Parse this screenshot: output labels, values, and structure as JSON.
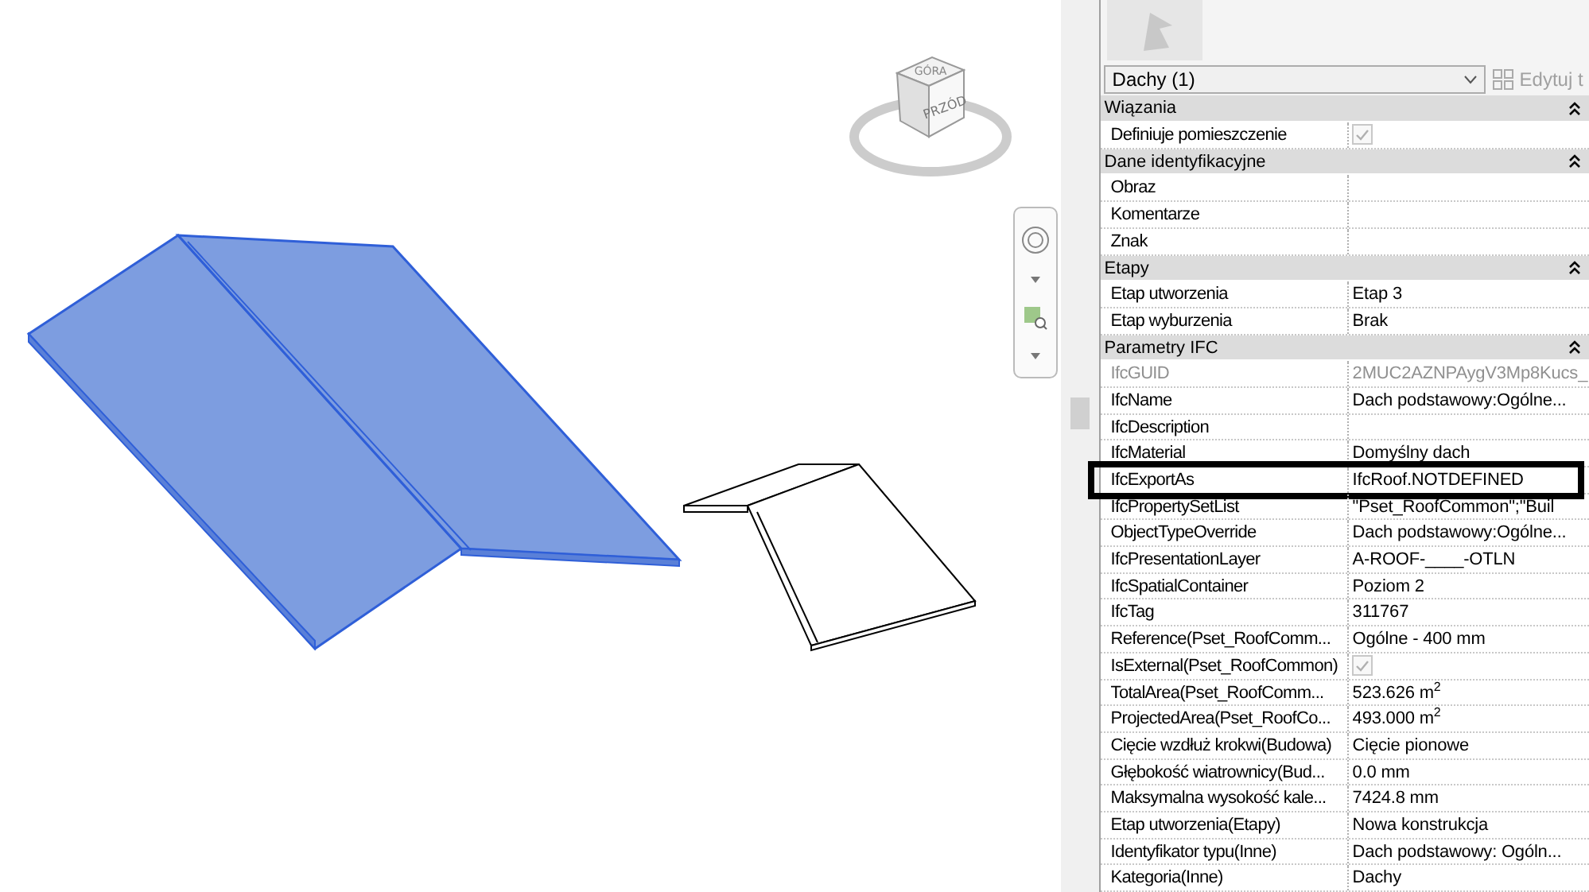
{
  "viewcube": {
    "top": "GÓRA",
    "front": "PRZÓD"
  },
  "properties": {
    "type_selector": "Dachy (1)",
    "edit_type_button": "Edytuj t",
    "rows": [
      {
        "kind": "group",
        "label": "Wiązania",
        "expanded": true
      },
      {
        "kind": "checkbox",
        "label": "Definiuje pomieszczenie",
        "checked": true
      },
      {
        "kind": "group",
        "label": "Dane identyfikacyjne",
        "expanded": true
      },
      {
        "kind": "text",
        "label": "Obraz"
      },
      {
        "kind": "text",
        "label": "Komentarze"
      },
      {
        "kind": "text",
        "label": "Znak"
      },
      {
        "kind": "group",
        "label": "Etapy",
        "expanded": true
      },
      {
        "kind": "text",
        "label": "Etap utworzenia",
        "value": "Etap 3"
      },
      {
        "kind": "text",
        "label": "Etap wyburzenia",
        "value": "Brak"
      },
      {
        "kind": "group",
        "label": "Parametry IFC",
        "expanded": true
      },
      {
        "kind": "text",
        "label": "IfcGUID",
        "value": "2MUC2AZNPAygV3Mp8Kucs_",
        "disabled": true
      },
      {
        "kind": "text",
        "label": "IfcName",
        "value": "Dach podstawowy:Ogólne..."
      },
      {
        "kind": "text",
        "label": "IfcDescription"
      },
      {
        "kind": "text",
        "label": "IfcMaterial",
        "value": "Domyślny dach"
      },
      {
        "kind": "text",
        "label": "IfcExportAs",
        "value": "IfcRoof.NOTDEFINED",
        "highlighted": true
      },
      {
        "kind": "text",
        "label": "IfcPropertySetList",
        "value": "\"Pset_RoofCommon\";\"Buil"
      },
      {
        "kind": "text",
        "label": "ObjectTypeOverride",
        "value": "Dach podstawowy:Ogólne..."
      },
      {
        "kind": "text",
        "label": "IfcPresentationLayer",
        "value": "A-ROOF-____-OTLN"
      },
      {
        "kind": "text",
        "label": "IfcSpatialContainer",
        "value": "Poziom 2"
      },
      {
        "kind": "text",
        "label": "IfcTag",
        "value": "311767"
      },
      {
        "kind": "text",
        "label": "Reference(Pset_RoofComm...",
        "value": "Ogólne - 400 mm"
      },
      {
        "kind": "checkbox",
        "label": "IsExternal(Pset_RoofCommon)",
        "checked": true
      },
      {
        "kind": "text",
        "label": "TotalArea(Pset_RoofComm...",
        "value": "523.626 m$^{2}$"
      },
      {
        "kind": "text",
        "label": "ProjectedArea(Pset_RoofCo...",
        "value": "493.000 m$^{2}$"
      },
      {
        "kind": "text",
        "label": "Cięcie wzdłuż krokwi(Budowa)",
        "value": "Cięcie pionowe"
      },
      {
        "kind": "text",
        "label": "Głębokość wiatrownicy(Bud...",
        "value": "0.0 mm"
      },
      {
        "kind": "text",
        "label": "Maksymalna wysokość kale...",
        "value": "7424.8 mm"
      },
      {
        "kind": "text",
        "label": "Etap utworzenia(Etapy)",
        "value": "Nowa konstrukcja"
      },
      {
        "kind": "text",
        "label": "Identyfikator typu(Inne)",
        "value": "Dach podstawowy: Ogóln..."
      },
      {
        "kind": "text",
        "label": "Kategoria(Inne)",
        "value": "Dachy"
      }
    ]
  }
}
